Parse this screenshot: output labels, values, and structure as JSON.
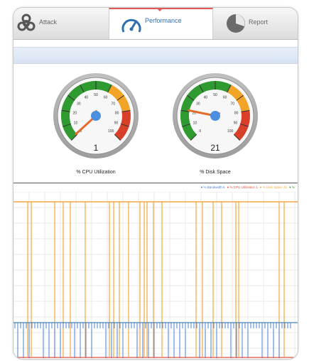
{
  "tabs": [
    {
      "label": "Attack",
      "icon": "biohazard-icon",
      "active": false
    },
    {
      "label": "Performance",
      "icon": "speedometer-icon",
      "active": true
    },
    {
      "label": "Report",
      "icon": "pie-chart-icon",
      "active": false
    }
  ],
  "gauges": {
    "cpu": {
      "title": "% CPU Utilization",
      "value": "1",
      "scale_labels": [
        "0",
        "10",
        "20",
        "30",
        "40",
        "50",
        "60",
        "70",
        "80",
        "90",
        "100"
      ]
    },
    "disk": {
      "title": "% Disk Space",
      "value": "21",
      "scale_labels": [
        "0",
        "10",
        "20",
        "30",
        "40",
        "50",
        "60",
        "70",
        "80",
        "90",
        "100"
      ]
    }
  },
  "colors": {
    "gauge_green": "#2f9a2f",
    "gauge_orange": "#f2a428",
    "gauge_red": "#d8402a",
    "needle": "#e36b2a",
    "hub": "#4a8fe0",
    "bandwidth": "#4a7fd0",
    "cpu": "#e05040",
    "disk": "#f4a640",
    "green_series": "#3a9a3a"
  },
  "legend": [
    {
      "text": "% Bandwidth 6",
      "color": "#4a7fd0"
    },
    {
      "text": "% CPU Utilization 1",
      "color": "#e05040"
    },
    {
      "text": "% Disk Space 21",
      "color": "#f4a640"
    },
    {
      "text": "% ",
      "color": "#3a9a3a"
    }
  ]
}
